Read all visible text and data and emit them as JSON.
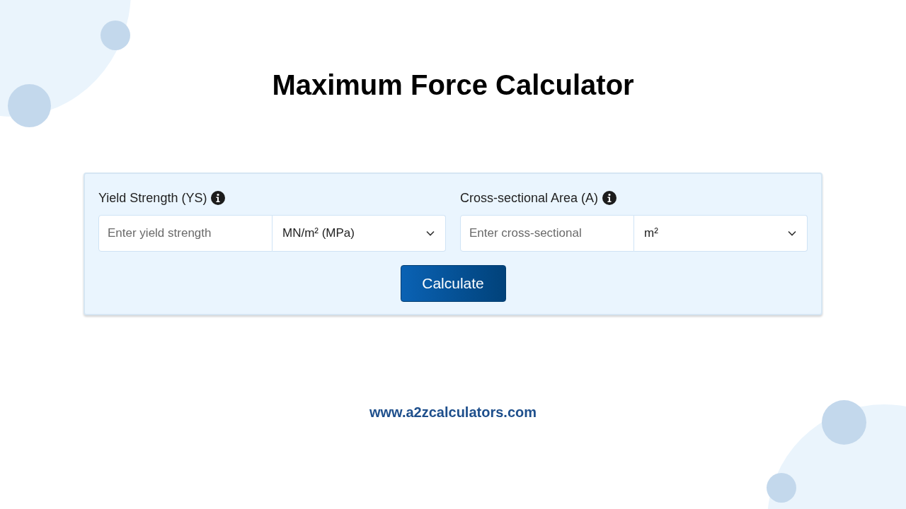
{
  "title": "Maximum Force Calculator",
  "fields": [
    {
      "label": "Yield Strength (YS)",
      "placeholder": "Enter yield strength",
      "unit": "MN/m² (MPa)"
    },
    {
      "label": "Cross-sectional Area (A)",
      "placeholder": "Enter cross-sectional",
      "unit": "m²"
    }
  ],
  "button": "Calculate",
  "footer": "www.a2zcalculators.com"
}
